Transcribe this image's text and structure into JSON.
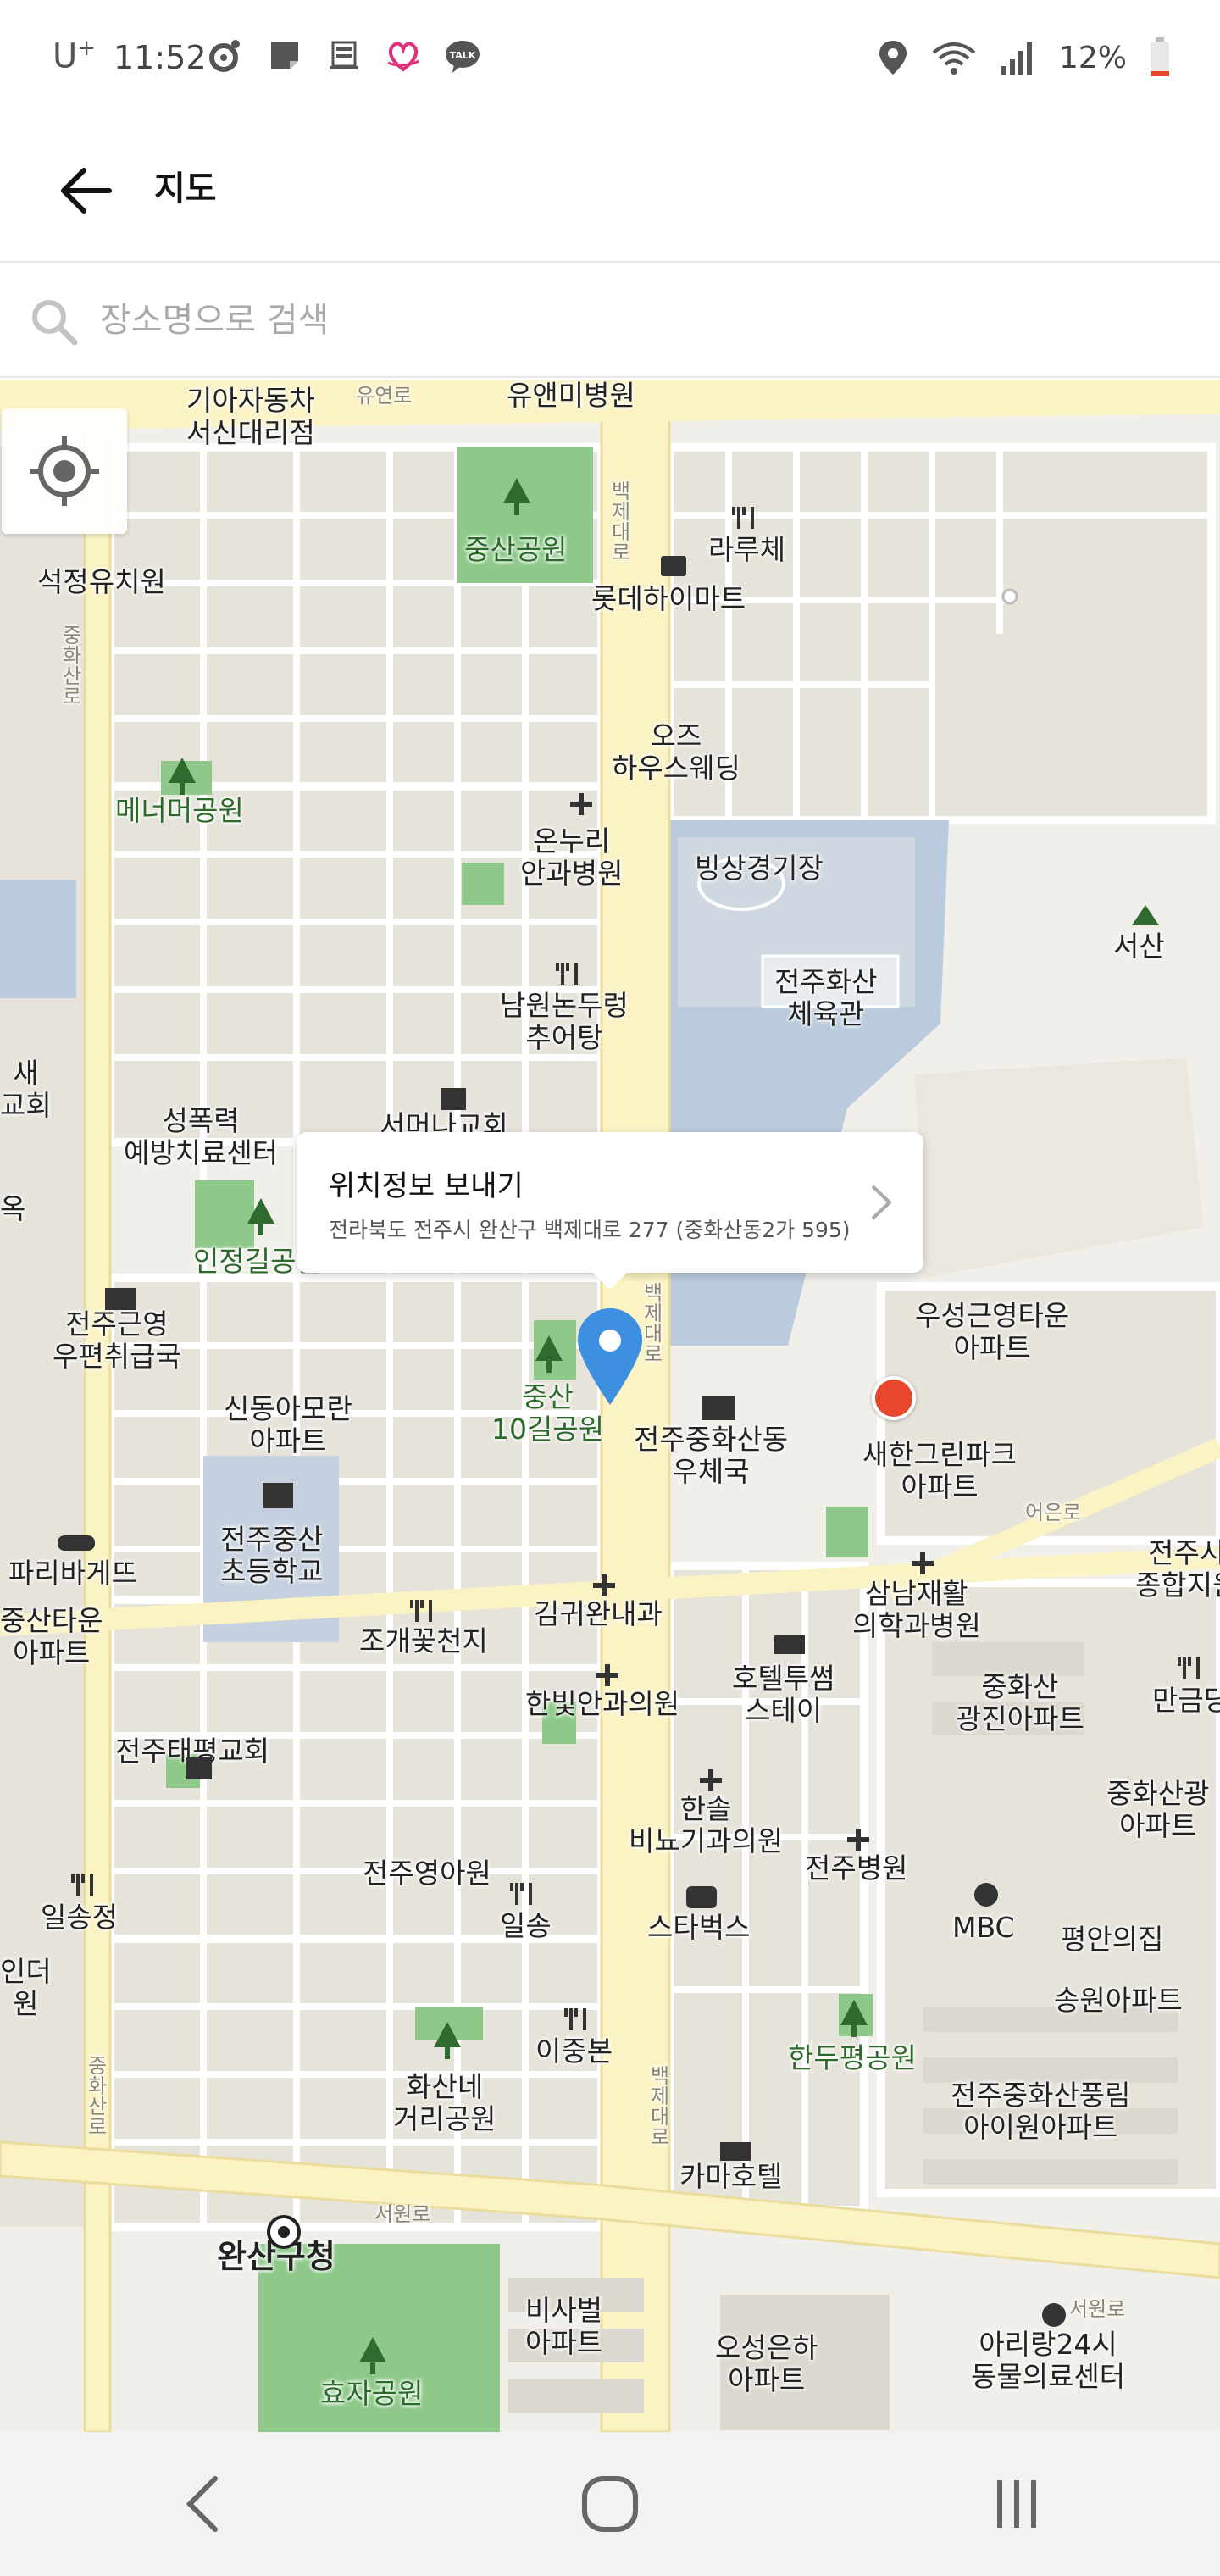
{
  "status_bar": {
    "carrier": "U",
    "carrier_sup": "+",
    "time": "11:52",
    "battery": "12%",
    "left_icons": [
      "media-icon",
      "note-icon",
      "device-icon",
      "heart-icon",
      "kakaotalk-icon"
    ],
    "talk_label": "TALK"
  },
  "app_bar": {
    "title": "지도",
    "back_icon": "arrow-left-icon"
  },
  "search": {
    "placeholder": "장소명으로 검색",
    "icon": "search-icon"
  },
  "map": {
    "labels": {
      "kia": "기아자동차\n서신대리점",
      "yuwon_ro_top": "유연로",
      "uanmi": "유앤미병원",
      "jungsan_park": "중산공원",
      "larche": "라루체",
      "lotte": "롯데하이마트",
      "seokjeong": "석정유치원",
      "oz": "오즈\n하우스웨딩",
      "menermer": "메너머공원",
      "onnuri": "온누리\n안과병원",
      "ice_rink": "빙상경기장",
      "seosan": "서산",
      "namwon": "남원논두렁\n추어탕",
      "jeonju_hwasan": "전주화산\n체육관",
      "sungpokryeok": "성폭력\n예방치료센터",
      "injeonggil": "인정길공원",
      "seomunna": "서머나교회",
      "woosung": "우성근영타운\n아파트",
      "saehan": "새한그린파크\n아파트",
      "jeonju_post": "전주근영\n우편취급국",
      "sindong": "신동아모란\n아파트",
      "jungsan10": "중산\n10길공원",
      "jeonju_hwasan_post": "전주중화산동\n우체국",
      "jungsan_school": "전주중산\n초등학교",
      "paris": "파리바게뜨",
      "kimgwiwan": "김귀완내과",
      "samnam": "삼남재활\n의학과병원",
      "jeonju_general": "전주시\n종합지원",
      "jungsan_town": "중산타운\n아파트",
      "jogae": "조개꽃천지",
      "hotel_twoseom": "호텔투썸\n스테이",
      "hwasan_gwangjin": "중화산\n광진아파트",
      "mangeum": "만금당",
      "hanbit": "한빛안과의원",
      "taepyeong_church": "전주태평교회",
      "hansol": "한솔\n비뇨기과의원",
      "jeonju_hospital": "전주병원",
      "hwasan_gwang_apt": "중화산광\n아파트",
      "jeonju_kinder": "전주영아원",
      "ilsong1": "일송정",
      "ilsong2": "일송",
      "starbucks": "스타벅스",
      "mbc": "MBC",
      "pyeongan": "평안의집",
      "songwon": "송원아파트",
      "handuepyeong": "한두평공원",
      "leejungbon": "이중본",
      "hwasane_park": "화산네\n거리공원",
      "pungrim": "전주중화산풍림\n아이원아파트",
      "kama": "카마호텔",
      "wansan_gu": "완산구청",
      "seowon_ro1": "서원로",
      "seowon_ro2": "서원로",
      "bisabeol": "비사벌\n아파트",
      "oseongeunha": "오성은하\n아파트",
      "arirang": "아리랑24시\n동물의료센터",
      "hyoja": "효자공원",
      "ieun_ro": "어은로",
      "baekje_ro1": "백\n제\n대\n로",
      "baekje_ro2": "백\n제\n대\n로",
      "baekje_ro3": "백\n제\n대\n로",
      "jungsan_ro1": "중\n화\n산\n로",
      "jungsan_ro2": "중\n화\n산\n로",
      "church_left": "새\n교회",
      "ok": "옥",
      "indeo": "인더\n원"
    },
    "callout": {
      "title": "위치정보 보내기",
      "address": "전라북도 전주시 완산구 백제대로 277 (중화산동2가 595)"
    },
    "my_location_icon": "crosshair-icon",
    "pin_color": "#3d8fe0",
    "marker_color": "#e8472c"
  },
  "nav_bar": {
    "back": "chevron-left-icon",
    "home": "home-icon",
    "recents": "recents-icon"
  },
  "colors": {
    "main_road": "#fbf3c4",
    "road": "#ffffff",
    "block": "#ece9e1",
    "park": "#8ec98a",
    "water": "#b9cbdd"
  }
}
